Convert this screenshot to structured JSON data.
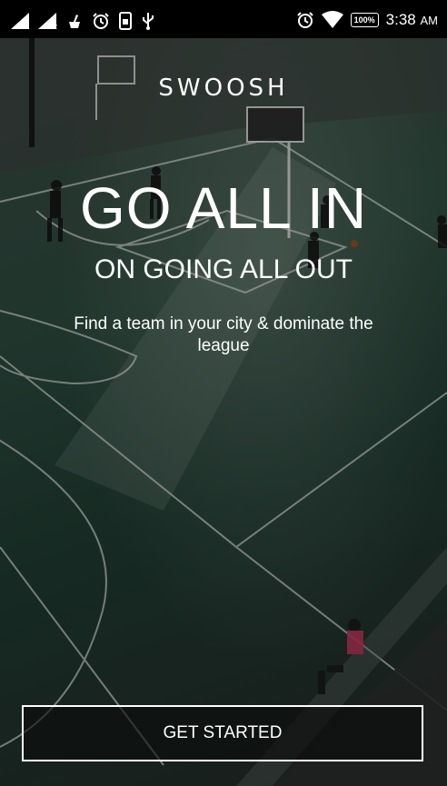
{
  "status_bar": {
    "sim1": "1",
    "sim2": "2",
    "battery": "100%",
    "time": "3:38",
    "ampm": "AM",
    "icons": [
      "signal-icon",
      "signal-icon",
      "cleaner-icon",
      "alarm-icon",
      "storage-icon",
      "usb-icon",
      "alarm-icon",
      "wifi-icon",
      "battery-icon"
    ]
  },
  "app": {
    "brand": "SWOOSH",
    "headline": "GO ALL IN",
    "subheadline": "ON GOING ALL OUT",
    "tagline": "Find a team in your city & dominate the league",
    "cta_label": "GET STARTED"
  }
}
